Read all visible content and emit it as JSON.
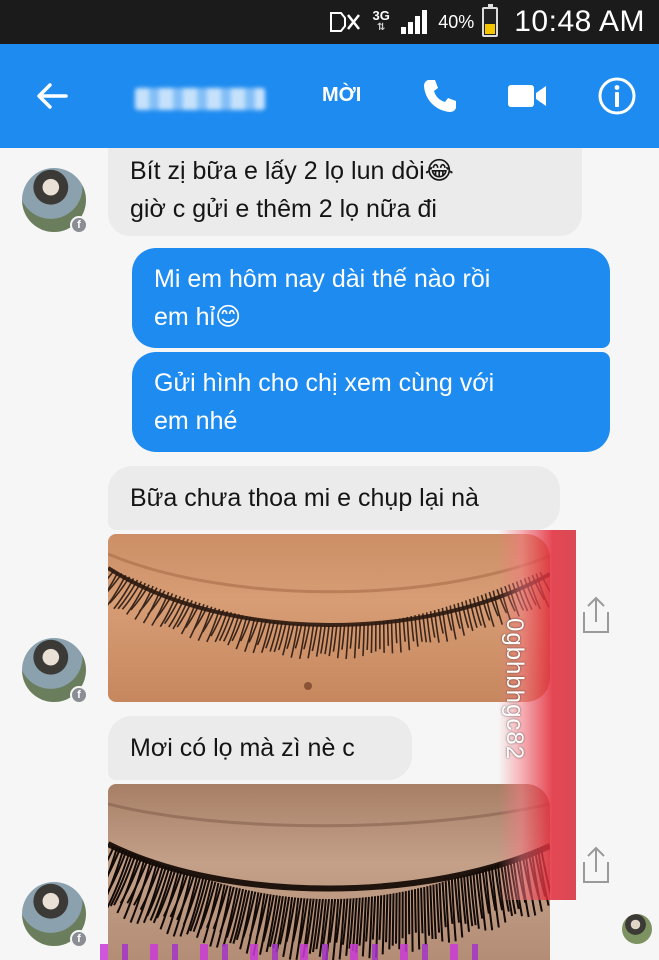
{
  "status_bar": {
    "network": "3G",
    "battery": "40%",
    "battery_level": 0.4,
    "time": "10:48 AM"
  },
  "app_bar": {
    "invite_label": "MỜI",
    "icons": [
      "back-arrow-icon",
      "phone-icon",
      "video-camera-icon",
      "info-icon"
    ]
  },
  "messages": [
    {
      "direction": "incoming",
      "lines": [
        "Bít zị bữa e lấy 2 lọ lun dòi😂",
        "giờ c gửi e thêm 2 lọ nữa đi"
      ]
    },
    {
      "direction": "outgoing",
      "lines": [
        "Mi em hôm nay dài thế nào rồi",
        "em hỉ😊"
      ]
    },
    {
      "direction": "outgoing",
      "lines": [
        "Gửi hình cho chị xem cùng với",
        "em nhé"
      ]
    },
    {
      "direction": "incoming",
      "lines": [
        "Bữa chưa thoa mi e chụp lại nà"
      ]
    },
    {
      "direction": "incoming",
      "type": "photo",
      "subject": "eyelash-closeup-before"
    },
    {
      "direction": "incoming",
      "lines": [
        "Mơi có lọ mà zì nè c"
      ]
    },
    {
      "direction": "incoming",
      "type": "photo",
      "subject": "eyelash-closeup-after"
    }
  ],
  "watermark": {
    "text": "0gbhbhgc82"
  },
  "colors": {
    "accent": "#1e8bf0",
    "status_bar": "#1b1b1b",
    "incoming_bubble": "#ebebeb",
    "background": "#f6f6f6"
  }
}
